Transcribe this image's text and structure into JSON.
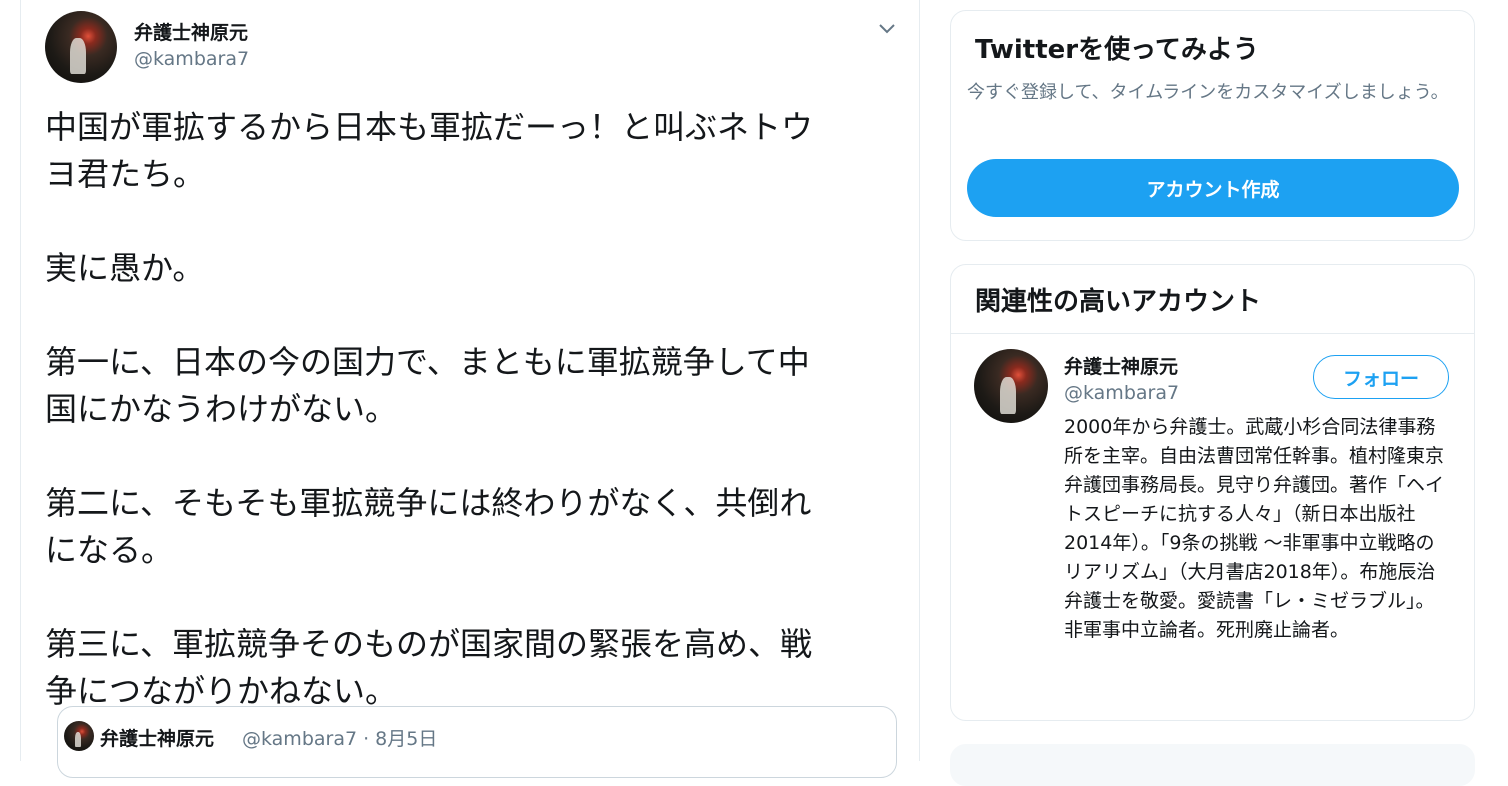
{
  "tweet": {
    "author_name": "弁護士神原元",
    "author_handle": "@kambara7",
    "text": "中国が軍拡するから日本も軍拡だーっ！と叫ぶネトウ\nヨ君たち。\n\n実に愚か。\n\n第一に、日本の今の国力で、まともに軍拡競争して中\n国にかなうわけがない。\n\n第二に、そもそも軍拡競争には終わりがなく、共倒れ\nになる。\n\n第三に、軍拡競争そのものが国家間の緊張を高め、戦\n争につながりかねない。",
    "quoted": {
      "author_name": "弁護士神原元",
      "author_handle_date": "@kambara7 · 8月5日"
    }
  },
  "signup_card": {
    "title": "Twitterを使ってみよう",
    "description": "今すぐ登録して、タイムラインをカスタマイズしましょう。",
    "button_label": "アカウント作成"
  },
  "related_card": {
    "title": "関連性の高いアカウント",
    "account": {
      "name": "弁護士神原元",
      "handle": "@kambara7",
      "follow_label": "フォロー",
      "bio": "2000年から弁護士。武蔵小杉合同法律事務所を主宰。自由法曹団常任幹事。植村隆東京弁護団事務局長。見守り弁護団。著作「ヘイトスピーチに抗する人々」（新日本出版社2014年）。「9条の挑戦 ～非軍事中立戦略のリアリズム」（大月書店2018年）。布施辰治弁護士を敬愛。愛読書「レ・ミゼラブル」。非軍事中立論者。死刑廃止論者。"
    }
  },
  "colors": {
    "accent": "#1da1f2",
    "secondary_text": "#657786",
    "border": "#e6ecf0"
  },
  "icons": {
    "tweet_menu": "chevron-down-icon"
  }
}
